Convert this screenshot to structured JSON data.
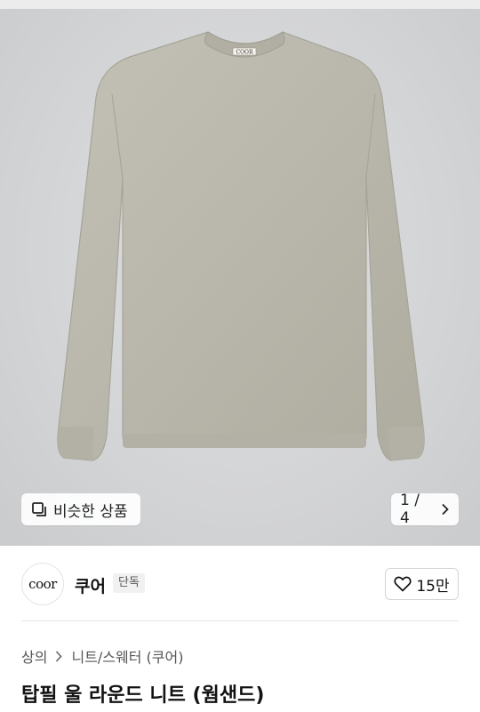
{
  "gallery": {
    "similar_label": "비슷한 상품",
    "counter": "1 / 4",
    "garment_label": "COOR",
    "colors": {
      "background": "#d4d5d7",
      "garment": "#bab8ad"
    }
  },
  "brand": {
    "logo_text": "coor",
    "name": "쿠어",
    "badge": "단독"
  },
  "like": {
    "count": "15만"
  },
  "breadcrumb": {
    "category": "상의",
    "subcategory": "니트/스웨터 (쿠어)"
  },
  "product": {
    "title": "탑필 울 라운드 니트 (웜샌드)"
  }
}
